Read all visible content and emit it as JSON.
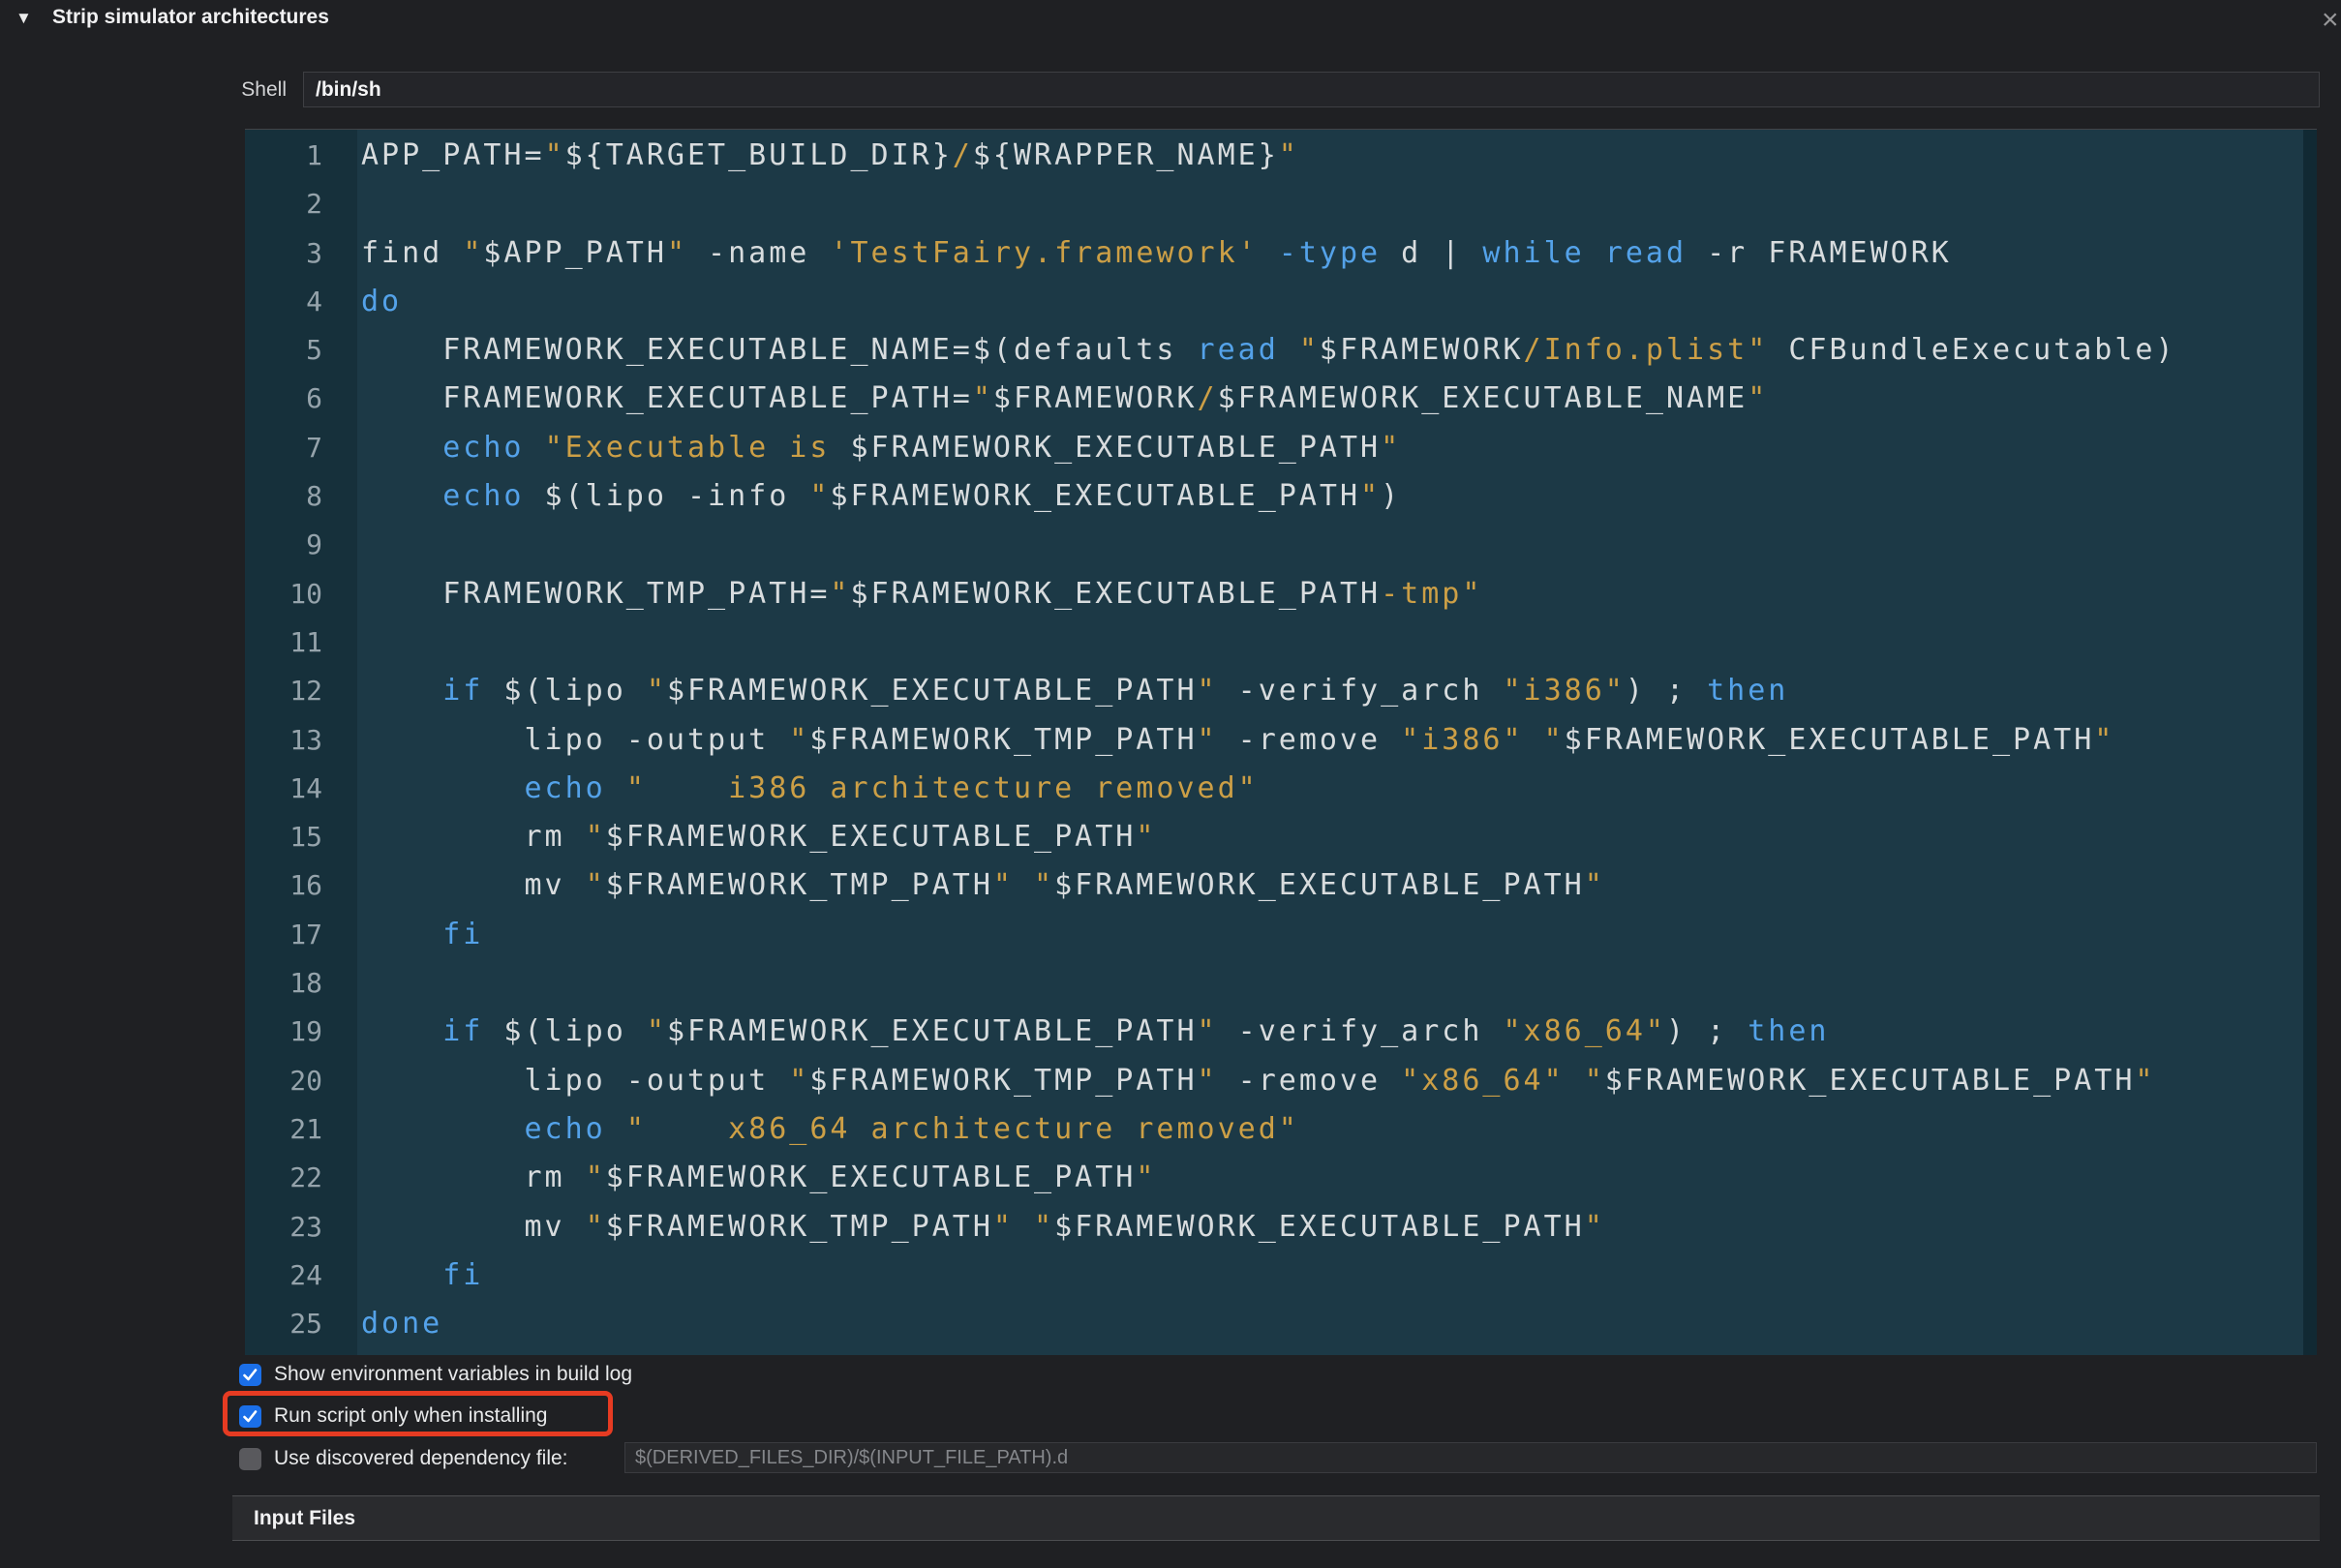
{
  "window": {
    "title": "Strip simulator architectures",
    "disclosure_icon": "▼",
    "close_icon": "×"
  },
  "shell": {
    "label": "Shell",
    "value": "/bin/sh"
  },
  "editor": {
    "lines": [
      {
        "n": 1,
        "tokens": [
          [
            "p",
            "APP_PATH="
          ],
          [
            "s",
            "\""
          ],
          [
            "p",
            "${TARGET_BUILD_DIR}"
          ],
          [
            "s",
            "/"
          ],
          [
            "p",
            "${WRAPPER_NAME}"
          ],
          [
            "s",
            "\""
          ]
        ]
      },
      {
        "n": 2,
        "tokens": []
      },
      {
        "n": 3,
        "tokens": [
          [
            "p",
            "find "
          ],
          [
            "s",
            "\""
          ],
          [
            "p",
            "$APP_PATH"
          ],
          [
            "s",
            "\""
          ],
          [
            "p",
            " -name "
          ],
          [
            "s",
            "'TestFairy.framework'"
          ],
          [
            "p",
            " "
          ],
          [
            "k",
            "-type"
          ],
          [
            "p",
            " d | "
          ],
          [
            "k",
            "while"
          ],
          [
            "p",
            " "
          ],
          [
            "k",
            "read"
          ],
          [
            "p",
            " -r FRAMEWORK"
          ]
        ]
      },
      {
        "n": 4,
        "tokens": [
          [
            "k",
            "do"
          ]
        ]
      },
      {
        "n": 5,
        "tokens": [
          [
            "p",
            "    FRAMEWORK_EXECUTABLE_NAME=$(defaults "
          ],
          [
            "k",
            "read"
          ],
          [
            "p",
            " "
          ],
          [
            "s",
            "\""
          ],
          [
            "p",
            "$FRAMEWORK"
          ],
          [
            "s",
            "/Info.plist\""
          ],
          [
            "p",
            " CFBundleExecutable)"
          ]
        ]
      },
      {
        "n": 6,
        "tokens": [
          [
            "p",
            "    FRAMEWORK_EXECUTABLE_PATH="
          ],
          [
            "s",
            "\""
          ],
          [
            "p",
            "$FRAMEWORK"
          ],
          [
            "s",
            "/"
          ],
          [
            "p",
            "$FRAMEWORK_EXECUTABLE_NAME"
          ],
          [
            "s",
            "\""
          ]
        ]
      },
      {
        "n": 7,
        "tokens": [
          [
            "p",
            "    "
          ],
          [
            "k",
            "echo"
          ],
          [
            "p",
            " "
          ],
          [
            "s",
            "\"Executable is "
          ],
          [
            "p",
            "$FRAMEWORK_EXECUTABLE_PATH"
          ],
          [
            "s",
            "\""
          ]
        ]
      },
      {
        "n": 8,
        "tokens": [
          [
            "p",
            "    "
          ],
          [
            "k",
            "echo"
          ],
          [
            "p",
            " $(lipo -info "
          ],
          [
            "s",
            "\""
          ],
          [
            "p",
            "$FRAMEWORK_EXECUTABLE_PATH"
          ],
          [
            "s",
            "\""
          ],
          [
            "p",
            ")"
          ]
        ]
      },
      {
        "n": 9,
        "tokens": []
      },
      {
        "n": 10,
        "tokens": [
          [
            "p",
            "    FRAMEWORK_TMP_PATH="
          ],
          [
            "s",
            "\""
          ],
          [
            "p",
            "$FRAMEWORK_EXECUTABLE_PATH"
          ],
          [
            "s",
            "-tmp\""
          ]
        ]
      },
      {
        "n": 11,
        "tokens": []
      },
      {
        "n": 12,
        "tokens": [
          [
            "p",
            "    "
          ],
          [
            "k",
            "if"
          ],
          [
            "p",
            " $(lipo "
          ],
          [
            "s",
            "\""
          ],
          [
            "p",
            "$FRAMEWORK_EXECUTABLE_PATH"
          ],
          [
            "s",
            "\""
          ],
          [
            "p",
            " -verify_arch "
          ],
          [
            "s",
            "\"i386\""
          ],
          [
            "p",
            ") ; "
          ],
          [
            "k",
            "then"
          ]
        ]
      },
      {
        "n": 13,
        "tokens": [
          [
            "p",
            "        lipo -output "
          ],
          [
            "s",
            "\""
          ],
          [
            "p",
            "$FRAMEWORK_TMP_PATH"
          ],
          [
            "s",
            "\""
          ],
          [
            "p",
            " -remove "
          ],
          [
            "s",
            "\"i386\""
          ],
          [
            "p",
            " "
          ],
          [
            "s",
            "\""
          ],
          [
            "p",
            "$FRAMEWORK_EXECUTABLE_PATH"
          ],
          [
            "s",
            "\""
          ]
        ]
      },
      {
        "n": 14,
        "tokens": [
          [
            "p",
            "        "
          ],
          [
            "k",
            "echo"
          ],
          [
            "p",
            " "
          ],
          [
            "s",
            "\"    i386 architecture removed\""
          ]
        ]
      },
      {
        "n": 15,
        "tokens": [
          [
            "p",
            "        rm "
          ],
          [
            "s",
            "\""
          ],
          [
            "p",
            "$FRAMEWORK_EXECUTABLE_PATH"
          ],
          [
            "s",
            "\""
          ]
        ]
      },
      {
        "n": 16,
        "tokens": [
          [
            "p",
            "        mv "
          ],
          [
            "s",
            "\""
          ],
          [
            "p",
            "$FRAMEWORK_TMP_PATH"
          ],
          [
            "s",
            "\""
          ],
          [
            "p",
            " "
          ],
          [
            "s",
            "\""
          ],
          [
            "p",
            "$FRAMEWORK_EXECUTABLE_PATH"
          ],
          [
            "s",
            "\""
          ]
        ]
      },
      {
        "n": 17,
        "tokens": [
          [
            "p",
            "    "
          ],
          [
            "k",
            "fi"
          ]
        ]
      },
      {
        "n": 18,
        "tokens": []
      },
      {
        "n": 19,
        "tokens": [
          [
            "p",
            "    "
          ],
          [
            "k",
            "if"
          ],
          [
            "p",
            " $(lipo "
          ],
          [
            "s",
            "\""
          ],
          [
            "p",
            "$FRAMEWORK_EXECUTABLE_PATH"
          ],
          [
            "s",
            "\""
          ],
          [
            "p",
            " -verify_arch "
          ],
          [
            "s",
            "\"x86_64\""
          ],
          [
            "p",
            ") ; "
          ],
          [
            "k",
            "then"
          ]
        ]
      },
      {
        "n": 20,
        "tokens": [
          [
            "p",
            "        lipo -output "
          ],
          [
            "s",
            "\""
          ],
          [
            "p",
            "$FRAMEWORK_TMP_PATH"
          ],
          [
            "s",
            "\""
          ],
          [
            "p",
            " -remove "
          ],
          [
            "s",
            "\"x86_64\""
          ],
          [
            "p",
            " "
          ],
          [
            "s",
            "\""
          ],
          [
            "p",
            "$FRAMEWORK_EXECUTABLE_PATH"
          ],
          [
            "s",
            "\""
          ]
        ]
      },
      {
        "n": 21,
        "tokens": [
          [
            "p",
            "        "
          ],
          [
            "k",
            "echo"
          ],
          [
            "p",
            " "
          ],
          [
            "s",
            "\"    x86_64 architecture removed\""
          ]
        ]
      },
      {
        "n": 22,
        "tokens": [
          [
            "p",
            "        rm "
          ],
          [
            "s",
            "\""
          ],
          [
            "p",
            "$FRAMEWORK_EXECUTABLE_PATH"
          ],
          [
            "s",
            "\""
          ]
        ]
      },
      {
        "n": 23,
        "tokens": [
          [
            "p",
            "        mv "
          ],
          [
            "s",
            "\""
          ],
          [
            "p",
            "$FRAMEWORK_TMP_PATH"
          ],
          [
            "s",
            "\""
          ],
          [
            "p",
            " "
          ],
          [
            "s",
            "\""
          ],
          [
            "p",
            "$FRAMEWORK_EXECUTABLE_PATH"
          ],
          [
            "s",
            "\""
          ]
        ]
      },
      {
        "n": 24,
        "tokens": [
          [
            "p",
            "    "
          ],
          [
            "k",
            "fi"
          ]
        ]
      },
      {
        "n": 25,
        "tokens": [
          [
            "k",
            "done"
          ]
        ]
      }
    ]
  },
  "options": [
    {
      "label": "Show environment variables in build log",
      "checked": true,
      "highlighted": false
    },
    {
      "label": "Run script only when installing",
      "checked": true,
      "highlighted": true
    },
    {
      "label": "Use discovered dependency file:",
      "checked": false,
      "highlighted": false,
      "field_placeholder": "$(DERIVED_FILES_DIR)/$(INPUT_FILE_PATH).d",
      "field_value": ""
    }
  ],
  "input_files": {
    "label": "Input Files"
  },
  "colors": {
    "editor-bg": "#1C3946",
    "gutter-bg": "#16303B",
    "kw": "#54A2E9",
    "str": "#CC9F46",
    "check-blue": "#1B6FE8",
    "highlight-red": "#E63B22"
  }
}
